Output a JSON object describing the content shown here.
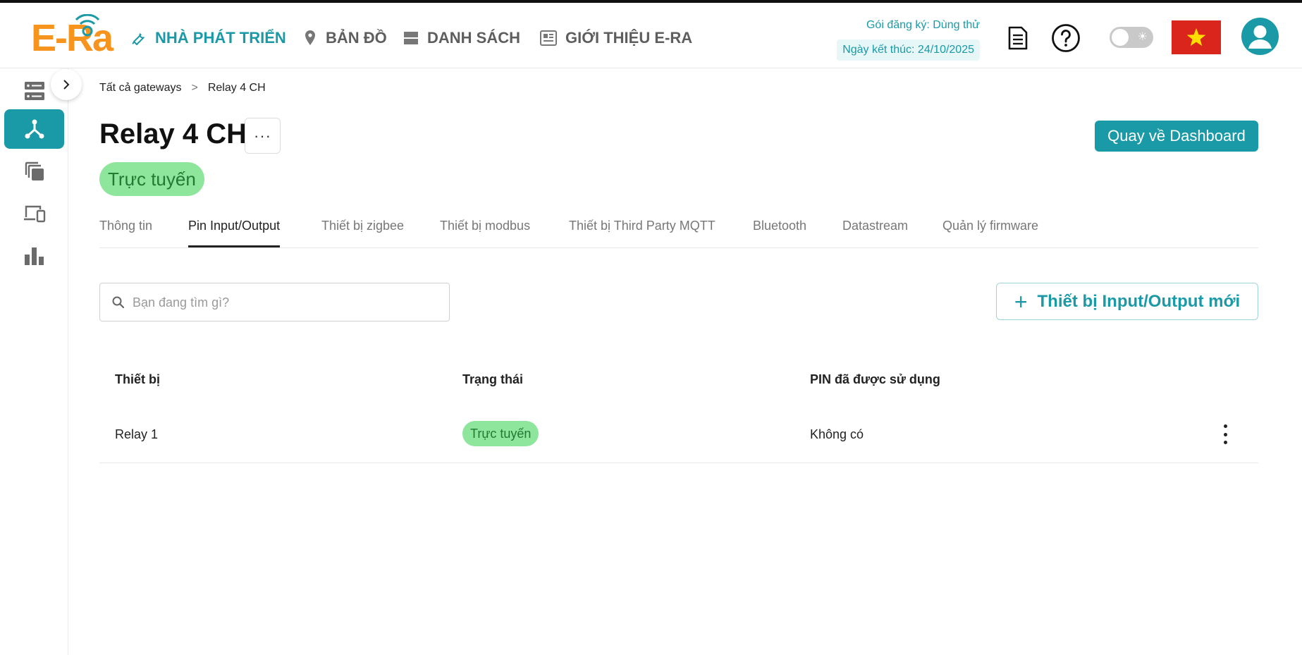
{
  "brand": {
    "logo_text": "E-Ra",
    "accent_color": "#1a9aa6",
    "logo_color": "#f7941d"
  },
  "header": {
    "nav": [
      {
        "label": "NHÀ PHÁT TRIỂN",
        "icon": "wrench-icon",
        "active": true
      },
      {
        "label": "BẢN ĐỒ",
        "icon": "map-pin-icon",
        "active": false
      },
      {
        "label": "DANH SÁCH",
        "icon": "list-icon",
        "active": false
      },
      {
        "label": "GIỚI THIỆU E-RA",
        "icon": "news-icon",
        "active": false
      }
    ],
    "plan_label": "Gói đăng ký: Dùng thử",
    "plan_end": "Ngày kết thúc: 24/10/2025",
    "icons": [
      "document-icon",
      "help-icon",
      "theme-toggle",
      "vietnam-flag-icon",
      "user-avatar-icon"
    ]
  },
  "sidebar": {
    "items": [
      {
        "icon": "server-icon",
        "active": false
      },
      {
        "icon": "network-icon",
        "active": true
      },
      {
        "icon": "layers-icon",
        "active": false
      },
      {
        "icon": "devices-icon",
        "active": false
      },
      {
        "icon": "bar-chart-icon",
        "active": false
      }
    ],
    "collapse_icon": "chevron-right-icon"
  },
  "breadcrumb": {
    "root": "Tất cả gateways",
    "separator": ">",
    "current": "Relay 4 CH"
  },
  "page": {
    "title": "Relay 4 CH",
    "more_label": "···",
    "status": "Trực tuyến",
    "status_color": "#8ee59c",
    "dashboard_button": "Quay về Dashboard"
  },
  "tabs": [
    {
      "label": "Thông tin",
      "active": false
    },
    {
      "label": "Pin Input/Output",
      "active": true
    },
    {
      "label": "Thiết bị zigbee",
      "active": false
    },
    {
      "label": "Thiết bị modbus",
      "active": false
    },
    {
      "label": "Thiết bị Third Party MQTT",
      "active": false
    },
    {
      "label": "Bluetooth",
      "active": false
    },
    {
      "label": "Datastream",
      "active": false
    },
    {
      "label": "Quản lý firmware",
      "active": false
    }
  ],
  "search": {
    "placeholder": "Bạn đang tìm gì?",
    "value": ""
  },
  "add_button": {
    "plus": "+",
    "label": "Thiết bị Input/Output mới"
  },
  "table": {
    "columns": [
      "Thiết bị",
      "Trạng thái",
      "PIN đã được sử dụng"
    ],
    "rows": [
      {
        "device": "Relay 1",
        "status": "Trực tuyến",
        "pins": "Không có"
      }
    ]
  }
}
